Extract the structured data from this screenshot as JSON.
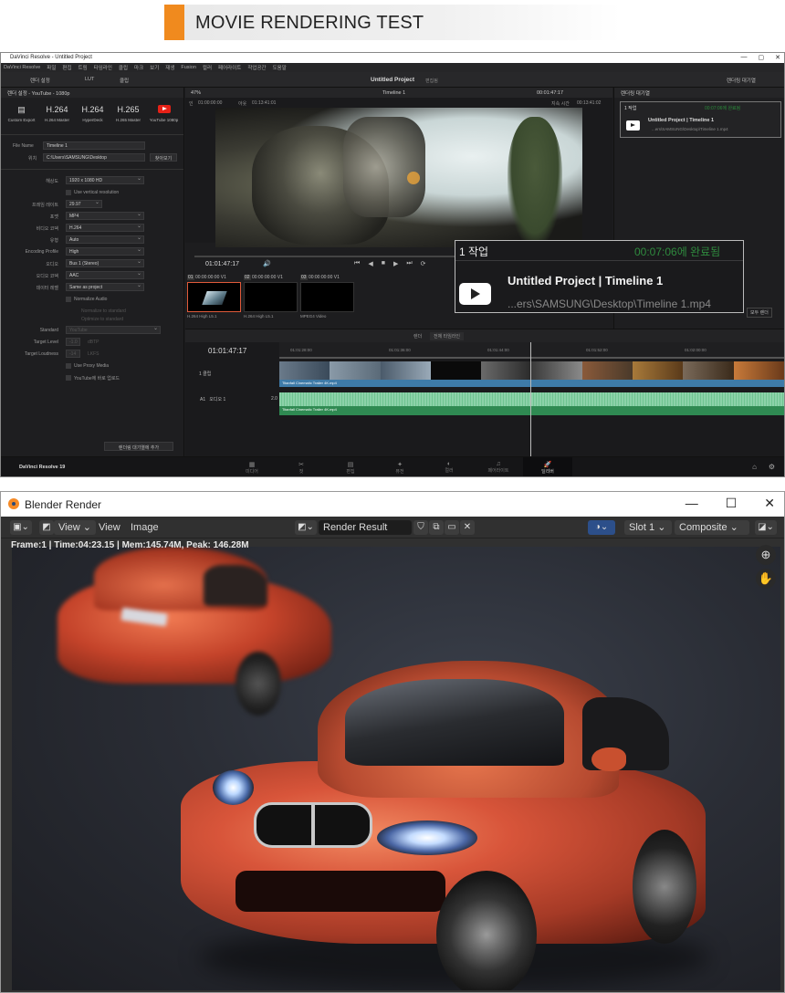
{
  "banner": {
    "title": "MOVIE RENDERING TEST",
    "accent_color": "#f08a1e"
  },
  "davinci": {
    "window_title": "DaVinci Resolve - Untitled Project",
    "menu": [
      "DaVinci Resolve",
      "파일",
      "편집",
      "트림",
      "타임라인",
      "클립",
      "마크",
      "보기",
      "재생",
      "Fusion",
      "컬러",
      "페어라이트",
      "작업공간",
      "도움말"
    ],
    "toolbar": {
      "render_settings": "렌더 설정",
      "lut": "LUT",
      "clip": "클립",
      "project": "Untitled Project",
      "edited": "편집됨",
      "queue": "렌더링 대기열"
    },
    "left_panel": {
      "header": "렌더 설정 - YouTube - 1080p",
      "presets": [
        {
          "big": "",
          "label": "Custom Export"
        },
        {
          "big": "H.264",
          "label": "H.264 Master"
        },
        {
          "big": "H.264",
          "label": "HyperDeck"
        },
        {
          "big": "H.265",
          "label": "H.265 Master"
        },
        {
          "big": "",
          "label": "YouTube 1080p"
        }
      ],
      "file_name_label": "File Name",
      "file_name": "Timeline 1",
      "location_label": "위치",
      "location": "C:\\Users\\SAMSUNG\\Desktop",
      "browse": "찾아보기",
      "rows": [
        {
          "label": "해상도",
          "value": "1920 x 1080 HD"
        },
        {
          "label": "프레임 레이트",
          "value": "29.97"
        },
        {
          "label": "포맷",
          "value": "MP4"
        },
        {
          "label": "비디오 코덱",
          "value": "H.264"
        },
        {
          "label": "유형",
          "value": "Auto"
        },
        {
          "label": "Encoding Profile",
          "value": "High"
        },
        {
          "label": "오디오",
          "value": "Bus 1 (Stereo)"
        },
        {
          "label": "오디오 코덱",
          "value": "AAC"
        },
        {
          "label": "데이터 레벨",
          "value": "Same as project"
        }
      ],
      "vertical": "Use vertical resolution",
      "normalize": "Normalize Audio",
      "normalize_standard": "Normalize to standard",
      "optimize_standard": "Optimize to standard",
      "standard_label": "Standard",
      "standard_value": "YouTube",
      "target_level_label": "Target Level",
      "target_level": "-1.0",
      "target_level_unit": "dBTP",
      "target_loudness_label": "Target Loudness",
      "target_loudness": "-14",
      "target_loudness_unit": "LKFS",
      "proxy": "Use Proxy Media",
      "youtube_upload": "YouTube에 바로 업로드",
      "add_queue": "렌더링 대기열에 추가"
    },
    "viewer": {
      "zoom": "47%",
      "timeline_name": "Timeline 1",
      "timecode_top": "00:01:47:17",
      "in_label": "인",
      "in_tc": "01:00:00:00",
      "out_label": "아웃",
      "out_tc": "01:13:41:01",
      "duration_label": "지속 시간",
      "duration": "00:13:41:02",
      "transport_tc": "01:01:47:17"
    },
    "clips": [
      {
        "num": "01",
        "tc": "00:00:00:00",
        "track": "V1",
        "label": "H.264 High L5.1"
      },
      {
        "num": "02",
        "tc": "00:00:00:00",
        "track": "V1",
        "label": "H.264 High L5.1"
      },
      {
        "num": "03",
        "tc": "00:00:00:00",
        "track": "V1",
        "label": "MPEG4 Video"
      }
    ],
    "timeline": {
      "timecode": "01:01:47:17",
      "render_label": "렌더",
      "render_range": "전체 타임라인",
      "ruler": [
        "01:01:28:00",
        "01:01:36:00",
        "01:01:44:00",
        "01:01:52:00",
        "01:02:00:00"
      ],
      "video_clip": "Titanfall Cinematic Trailer 4K.mp4",
      "audio_clip": "Titanfall Cinematic Trailer 4K.mp4",
      "video_track_clips": "1 클립",
      "audio_track_id": "A1",
      "audio_track_name": "오디오 1",
      "audio_ch": "2.0"
    },
    "right_panel": {
      "header": "렌더링 대기열",
      "job_num": "1 작업",
      "status": "00:07:06에 완료됨",
      "project": "Untitled Project | Timeline 1",
      "path": "...ers\\SAMSUNG\\Desktop\\Timeline 1.mp4",
      "all_render": "모두 렌더"
    },
    "pages": [
      {
        "icon": "▦",
        "label": "미디어"
      },
      {
        "icon": "✂",
        "label": "컷"
      },
      {
        "icon": "▤",
        "label": "편집"
      },
      {
        "icon": "✦",
        "label": "퓨전"
      },
      {
        "icon": "◐",
        "label": "컬러"
      },
      {
        "icon": "♫",
        "label": "페어라이트"
      },
      {
        "icon": "🚀",
        "label": "딜리버"
      }
    ],
    "app_name": "DaVinci Resolve 19"
  },
  "popup": {
    "job_num": "1 작업",
    "status": "00:07:06에 완료됨",
    "status_color": "#2f8a3e",
    "project": "Untitled Project | Timeline 1",
    "path": "...ers\\SAMSUNG\\Desktop\\Timeline 1.mp4"
  },
  "blender": {
    "window_title": "Blender Render",
    "view_menu": "View",
    "view2": "View",
    "image": "Image",
    "image_name": "Render Result",
    "slot": "Slot 1",
    "pass": "Composite",
    "info": "Frame:1 | Time:04:23.15 | Mem:145.74M, Peak: 146.28M"
  }
}
